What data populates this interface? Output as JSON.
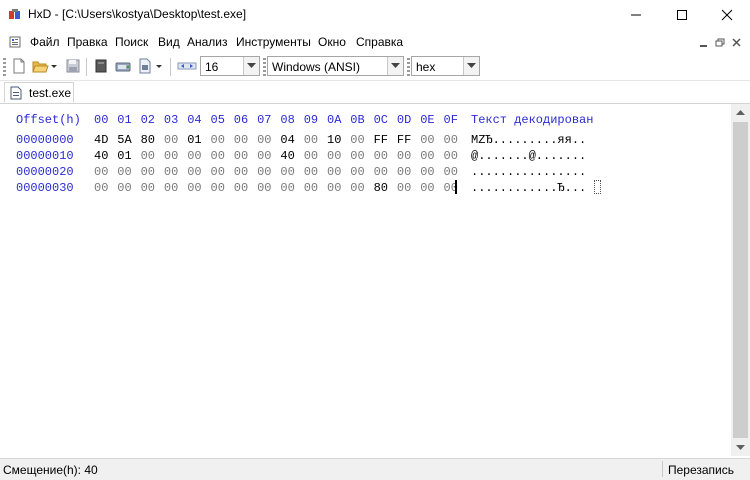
{
  "window": {
    "title": "HxD - [C:\\Users\\kostya\\Desktop\\test.exe]"
  },
  "menu": {
    "items": [
      "Файл",
      "Правка",
      "Поиск",
      "Вид",
      "Анализ",
      "Инструменты",
      "Окно",
      "Справка"
    ]
  },
  "toolbar": {
    "bytes_per_row": "16",
    "charset": "Windows (ANSI)",
    "offset_base": "hex",
    "icons": [
      "new-file-icon",
      "open-file-icon",
      "save-icon",
      "close-file-icon",
      "open-disk-icon",
      "open-ram-icon",
      "columns-icon"
    ]
  },
  "tabs": [
    {
      "label": "test.exe"
    }
  ],
  "hex": {
    "offset_header": "Offset(h)",
    "column_headers": [
      "00",
      "01",
      "02",
      "03",
      "04",
      "05",
      "06",
      "07",
      "08",
      "09",
      "0A",
      "0B",
      "0C",
      "0D",
      "0E",
      "0F"
    ],
    "decoded_header": "Текст декодирован",
    "rows": [
      {
        "offset": "00000000",
        "bytes": [
          "4D",
          "5A",
          "80",
          "00",
          "01",
          "00",
          "00",
          "00",
          "04",
          "00",
          "10",
          "00",
          "FF",
          "FF",
          "00",
          "00"
        ],
        "decoded": "MZЂ.........яя.."
      },
      {
        "offset": "00000010",
        "bytes": [
          "40",
          "01",
          "00",
          "00",
          "00",
          "00",
          "00",
          "00",
          "40",
          "00",
          "00",
          "00",
          "00",
          "00",
          "00",
          "00"
        ],
        "decoded": "@.......@......."
      },
      {
        "offset": "00000020",
        "bytes": [
          "00",
          "00",
          "00",
          "00",
          "00",
          "00",
          "00",
          "00",
          "00",
          "00",
          "00",
          "00",
          "00",
          "00",
          "00",
          "00"
        ],
        "decoded": "................"
      },
      {
        "offset": "00000030",
        "bytes": [
          "00",
          "00",
          "00",
          "00",
          "00",
          "00",
          "00",
          "00",
          "00",
          "00",
          "00",
          "00",
          "80",
          "00",
          "00",
          "00"
        ],
        "decoded": "............Ђ..."
      }
    ]
  },
  "status": {
    "offset": "Смещение(h): 40",
    "mode": "Перезапись"
  },
  "colors": {
    "header_blue": "#2b2bd4",
    "zero_byte_gray": "#7a7a7a"
  }
}
